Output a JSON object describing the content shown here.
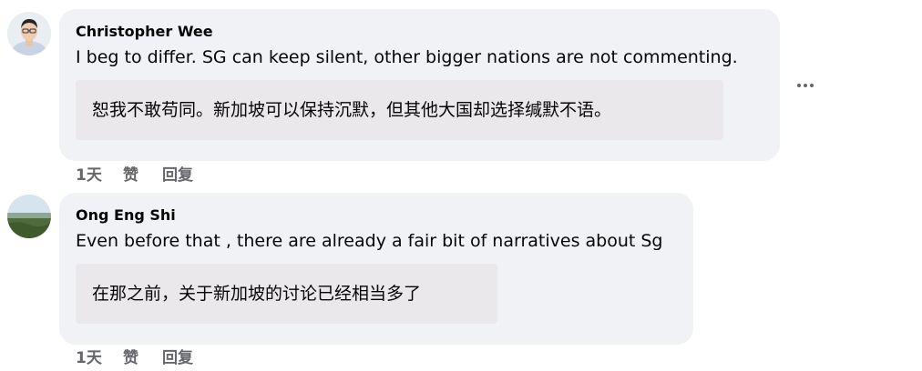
{
  "comments": [
    {
      "author": "Christopher Wee",
      "text": "I beg to differ. SG can keep silent, other bigger nations are not commenting.",
      "translation": "恕我不敢苟同。新加坡可以保持沉默，但其他大国却选择缄默不语。",
      "time": "1天",
      "like_label": "赞",
      "reply_label": "回复",
      "avatar_icon": "person-avatar-icon"
    },
    {
      "author": "Ong Eng Shi",
      "text": "Even before that , there are already a fair bit of narratives about Sg",
      "translation": "在那之前，关于新加坡的讨论已经相当多了",
      "time": "1天",
      "like_label": "赞",
      "reply_label": "回复",
      "avatar_icon": "landscape-avatar-icon"
    }
  ],
  "more_options_icon": "more-horizontal-icon",
  "colors": {
    "bubble": "#f0f2f5",
    "translation_box": "#ebe8eb",
    "secondary_text": "#65676b",
    "primary_text": "#050505"
  }
}
